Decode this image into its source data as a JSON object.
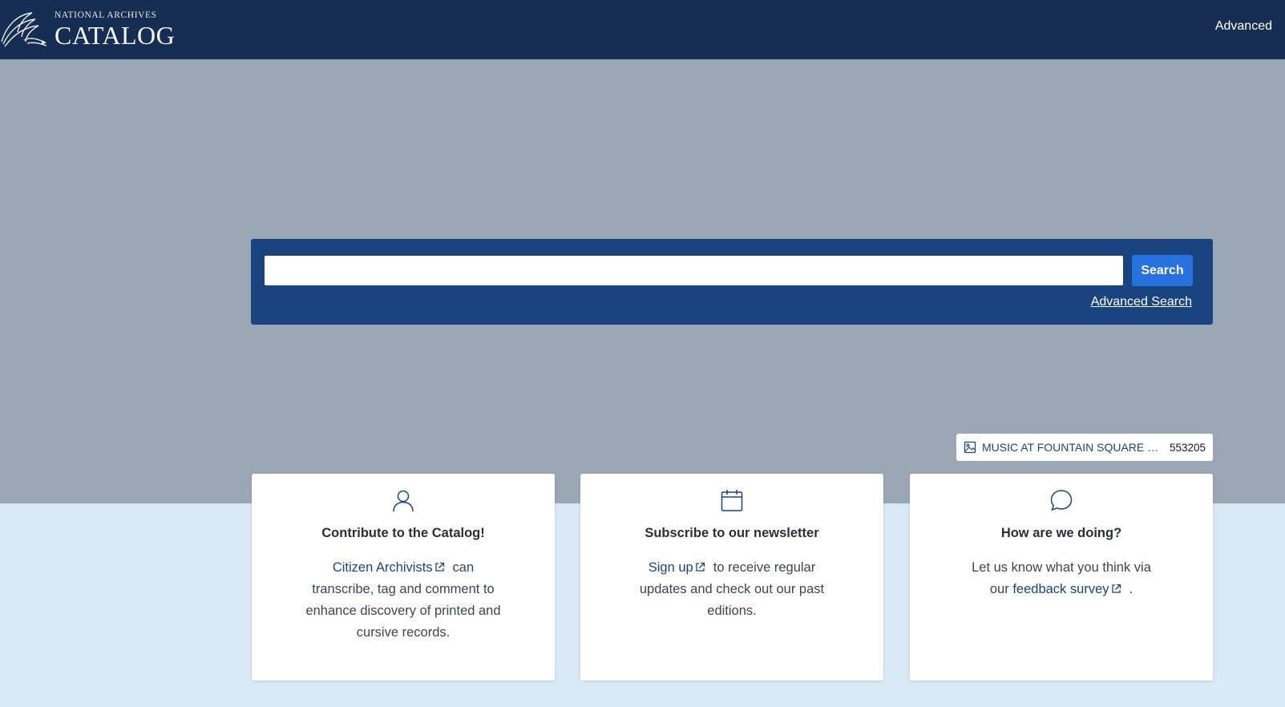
{
  "header": {
    "logo_line1": "NATIONAL ARCHIVES",
    "logo_line2": "CATALOG",
    "advanced_label": "Advanced"
  },
  "search": {
    "placeholder": "",
    "value": "",
    "button_label": "Search",
    "advanced_link": "Advanced Search"
  },
  "featured": {
    "icon": "image-icon",
    "title": "MUSIC AT FOUNTAIN SQUARE FIN...",
    "id": "553205"
  },
  "cards": [
    {
      "icon": "person-icon",
      "title": "Contribute to the Catalog!",
      "link_text": "Citizen Archivists",
      "text_after": "can transcribe, tag and comment to enhance discovery of printed and cursive records."
    },
    {
      "icon": "calendar-icon",
      "title": "Subscribe to our newsletter",
      "link_text": "Sign up",
      "text_after": "to receive regular updates and check out our past editions."
    },
    {
      "icon": "chat-icon",
      "title": "How are we doing?",
      "text_before": "Let us know what you think via our",
      "link_text": "feedback survey",
      "text_after": "."
    }
  ],
  "colors": {
    "header_bg": "#162e51",
    "hero_bg": "#9aa8b5",
    "search_panel_bg": "#1a4480",
    "search_button_bg": "#2672de",
    "page_bg": "#d9e8f6",
    "link": "#1a4480"
  }
}
